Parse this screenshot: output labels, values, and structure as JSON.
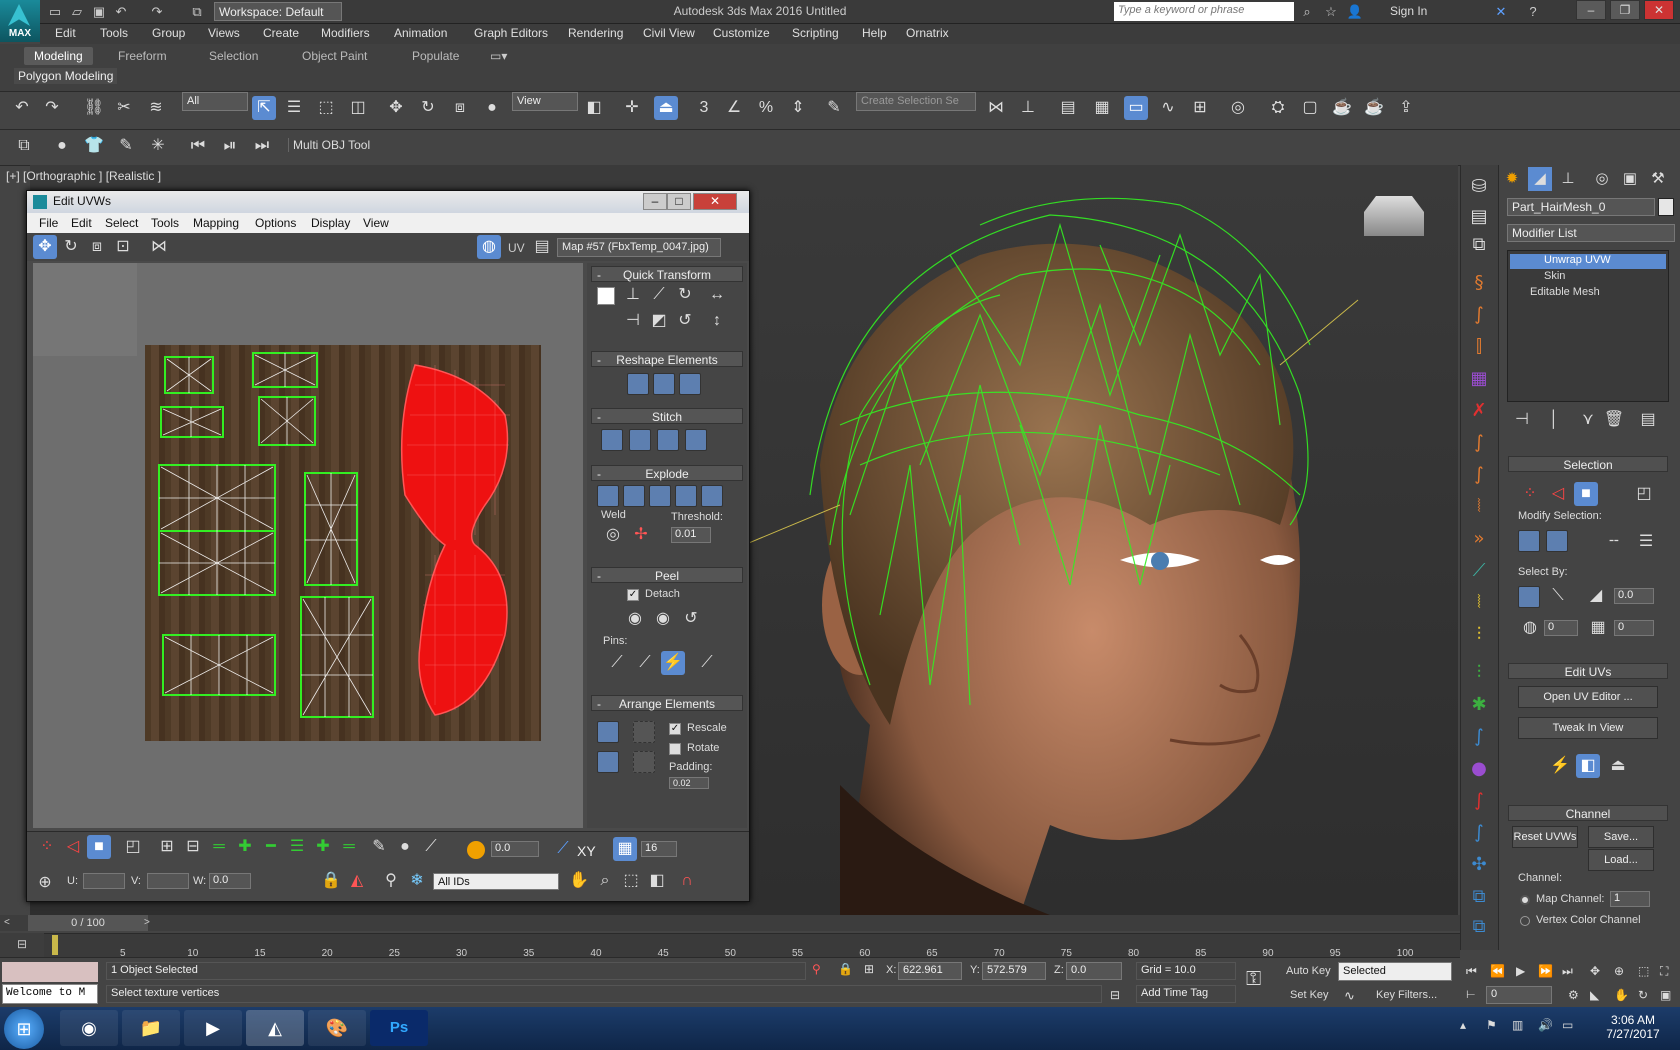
{
  "app": {
    "title": "Autodesk 3ds Max 2016    Untitled",
    "logo_text": "MAX",
    "workspace": "Workspace: Default",
    "search_placeholder": "Type a keyword or phrase",
    "signin": "Sign In"
  },
  "menu": [
    "Edit",
    "Tools",
    "Group",
    "Views",
    "Create",
    "Modifiers",
    "Animation",
    "Graph Editors",
    "Rendering",
    "Civil View",
    "Customize",
    "Scripting",
    "Help",
    "Ornatrix"
  ],
  "ribbon": {
    "tabs": [
      "Modeling",
      "Freeform",
      "Selection",
      "Object Paint",
      "Populate"
    ],
    "active": "Modeling",
    "sub": "Polygon Modeling"
  },
  "toolbar": {
    "filter": "All",
    "refcoord": "View",
    "selset_placeholder": "Create Selection Se",
    "multi_obj": "Multi OBJ Tool",
    "snap_num": "3"
  },
  "viewport": {
    "label": "[+] [Orthographic ] [Realistic ]"
  },
  "uv": {
    "title": "Edit UVWs",
    "menu": [
      "File",
      "Edit",
      "Select",
      "Tools",
      "Mapping",
      "Options",
      "Display",
      "View"
    ],
    "uv_label": "UV",
    "map": "Map #57 (FbxTemp_0047.jpg)",
    "rollouts": {
      "quick": "Quick Transform",
      "reshape": "Reshape Elements",
      "stitch": "Stitch",
      "explode": "Explode",
      "weld": "Weld",
      "threshold_label": "Threshold:",
      "threshold": "0.01",
      "peel": "Peel",
      "detach": "Detach",
      "pins": "Pins:",
      "arrange": "Arrange Elements",
      "rescale": "Rescale",
      "rotate": "Rotate",
      "padding": "Padding:",
      "padding_val": "0.02"
    },
    "bottom": {
      "spin1": "0.0",
      "xy": "XY",
      "num16": "16",
      "u": "U:",
      "v": "V:",
      "w": "W:",
      "w_val": "0.0",
      "ids": "All IDs"
    }
  },
  "cmd": {
    "object_name": "Part_HairMesh_0",
    "modifier_list": "Modifier List",
    "stack": [
      "Unwrap UVW",
      "Skin",
      "Editable Mesh"
    ],
    "selection": "Selection",
    "modify_selection": "Modify Selection:",
    "select_by": "Select By:",
    "sel_val1": "0.0",
    "sel_val2": "0",
    "sel_val3": "0",
    "edit_uvs": "Edit UVs",
    "open_uv_editor": "Open UV Editor ...",
    "tweak_in_view": "Tweak In View",
    "channel": "Channel",
    "reset_uvws": "Reset UVWs",
    "save": "Save...",
    "load": "Load...",
    "channel_label": "Channel:",
    "map_channel": "Map Channel:",
    "map_channel_val": "1",
    "vertex_color": "Vertex Color Channel"
  },
  "timeline": {
    "frame": "0 / 100",
    "ticks": [
      "5",
      "10",
      "15",
      "20",
      "25",
      "30",
      "35",
      "40",
      "45",
      "50",
      "55",
      "60",
      "65",
      "70",
      "75",
      "80",
      "85",
      "90",
      "95",
      "100"
    ]
  },
  "status": {
    "selected": "1 Object Selected",
    "prompt": "Select texture vertices",
    "welcome": "Welcome to M",
    "x_label": "X:",
    "x": "622.961",
    "y_label": "Y:",
    "y": "572.579",
    "z_label": "Z:",
    "z": "0.0",
    "grid": "Grid = 10.0",
    "add_time_tag": "Add Time Tag",
    "auto_key": "Auto Key",
    "set_key": "Set Key",
    "key_mode": "Selected",
    "key_filters": "Key Filters...",
    "frame_field": "0"
  },
  "taskbar": {
    "time": "3:06 AM",
    "date": "7/27/2017"
  },
  "colors": {
    "wire_green": "#33ee22",
    "selected_red": "#ee1111",
    "accent": "#5b8bd1"
  }
}
